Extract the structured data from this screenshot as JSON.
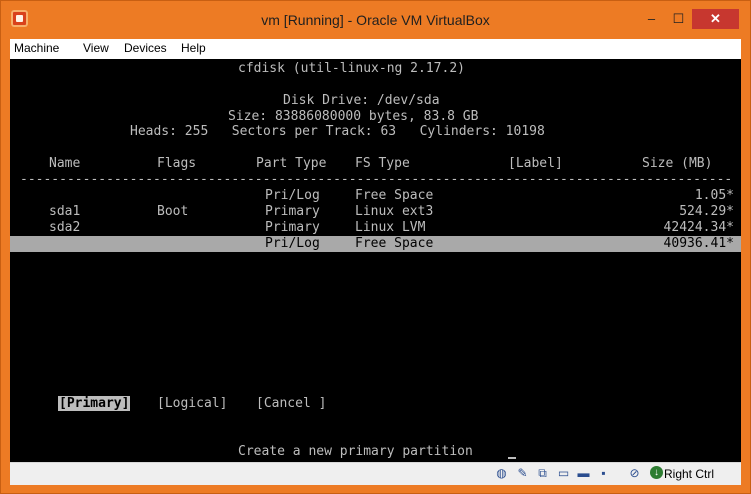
{
  "window": {
    "title": "vm [Running] - Oracle VM VirtualBox",
    "min_glyph": "–",
    "max_glyph": "☐",
    "close_glyph": "✕"
  },
  "menu": [
    "Machine",
    "View",
    "Devices",
    "Help"
  ],
  "cfdisk": {
    "header": "cfdisk (util-linux-ng 2.17.2)",
    "disk_drive": "Disk Drive: /dev/sda",
    "size_line": "Size: 83886080000 bytes, 83.8 GB",
    "geometry_line": "Heads: 255   Sectors per Track: 63   Cylinders: 10198",
    "columns": {
      "name": "Name",
      "flags": "Flags",
      "part_type": "Part Type",
      "fs_type": "FS Type",
      "label": "[Label]",
      "size": "Size (MB)"
    },
    "separator": "----------------------------------------------------------------------------------------------",
    "rows": [
      {
        "name": "",
        "flags": "",
        "part_type": "Pri/Log",
        "fs_type": "Free Space",
        "size": "1.05*"
      },
      {
        "name": "sda1",
        "flags": "Boot",
        "part_type": "Primary",
        "fs_type": "Linux ext3",
        "size": "524.29*"
      },
      {
        "name": "sda2",
        "flags": "",
        "part_type": "Primary",
        "fs_type": "Linux LVM",
        "size": "42424.34*"
      },
      {
        "name": "",
        "flags": "",
        "part_type": "Pri/Log",
        "fs_type": "Free Space",
        "size": "40936.41*"
      }
    ],
    "actions": [
      "[Primary]",
      "[Logical]",
      "[Cancel ]"
    ],
    "selected_action": "[Primary]",
    "prompt": "Create a new primary partition"
  },
  "status_bar": {
    "icons": [
      "hard-disk-icon",
      "optical-drive-icon",
      "network-icon",
      "shared-folders-icon",
      "display-icon",
      "video-capture-icon",
      "mouse-integration-icon",
      "host-key-icon"
    ],
    "host_key": "Right Ctrl"
  }
}
